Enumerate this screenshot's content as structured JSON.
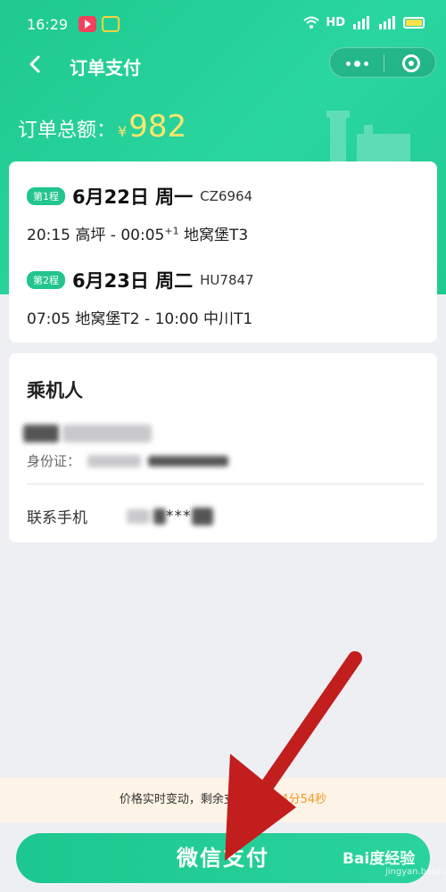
{
  "status_bar": {
    "time": "16:29",
    "network": "HD",
    "sim1": "4G",
    "sim2": "3G"
  },
  "nav": {
    "title": "订单支付"
  },
  "order": {
    "total_label": "订单总额：",
    "currency": "¥",
    "amount": "982"
  },
  "legs": [
    {
      "badge": "第1程",
      "date": "6月22日 周一",
      "flight_no": "CZ6964",
      "depart_time": "20:15",
      "depart_airport": "高坪",
      "arrive_time": "00:05",
      "next_day": "+1",
      "arrive_airport": "地窝堡T3"
    },
    {
      "badge": "第2程",
      "date": "6月23日 周二",
      "flight_no": "HU7847",
      "depart_time": "07:05",
      "depart_airport": "地窝堡T2",
      "arrive_time": "10:00",
      "next_day": "",
      "arrive_airport": "中川T1"
    }
  ],
  "passenger": {
    "section_title": "乘机人",
    "id_label": "身份证：",
    "phone_label": "联系手机",
    "phone_masked": "***"
  },
  "notice": {
    "text": "价格实时变动，剩余支付时间",
    "countdown": "14分54秒"
  },
  "pay_button": {
    "label": "微信支付"
  },
  "watermark": {
    "brand": "Bai度经验",
    "url": "jingyan.baidu.com"
  },
  "colors": {
    "brand_green": "#22c58d",
    "price_yellow": "#ffe56b",
    "countdown_orange": "#f39a2a",
    "arrow_red": "#c21e1e"
  }
}
